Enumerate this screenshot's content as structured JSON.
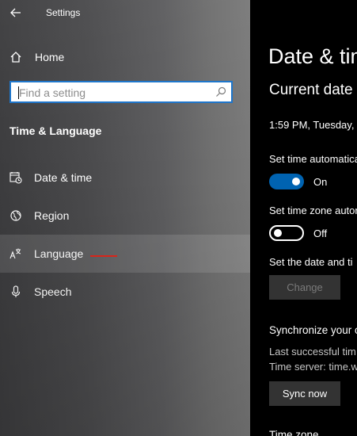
{
  "window": {
    "title": "Settings"
  },
  "sidebar": {
    "home_label": "Home",
    "search_placeholder": "Find a setting",
    "section_title": "Time & Language",
    "items": [
      {
        "label": "Date & time",
        "icon": "date-time-icon"
      },
      {
        "label": "Region",
        "icon": "globe-icon"
      },
      {
        "label": "Language",
        "icon": "language-icon",
        "selected": true
      },
      {
        "label": "Speech",
        "icon": "microphone-icon"
      }
    ]
  },
  "main": {
    "page_title": "Date & tim",
    "current_heading": "Current date",
    "current_datetime": "1:59 PM, Tuesday,",
    "set_time_auto_label": "Set time automatica",
    "set_time_auto_state": "On",
    "set_timezone_auto_label": "Set time zone autor",
    "set_timezone_auto_state": "Off",
    "set_manually_label": "Set the date and ti",
    "change_button": "Change",
    "sync_heading": "Synchronize your c",
    "last_sync": "Last successful tim",
    "time_server": "Time server: time.w",
    "sync_button": "Sync now",
    "timezone_heading": "Time zone"
  },
  "colors": {
    "accent": "#0063b1",
    "focus_border": "#1a73c9",
    "annotation": "#e0261b"
  }
}
